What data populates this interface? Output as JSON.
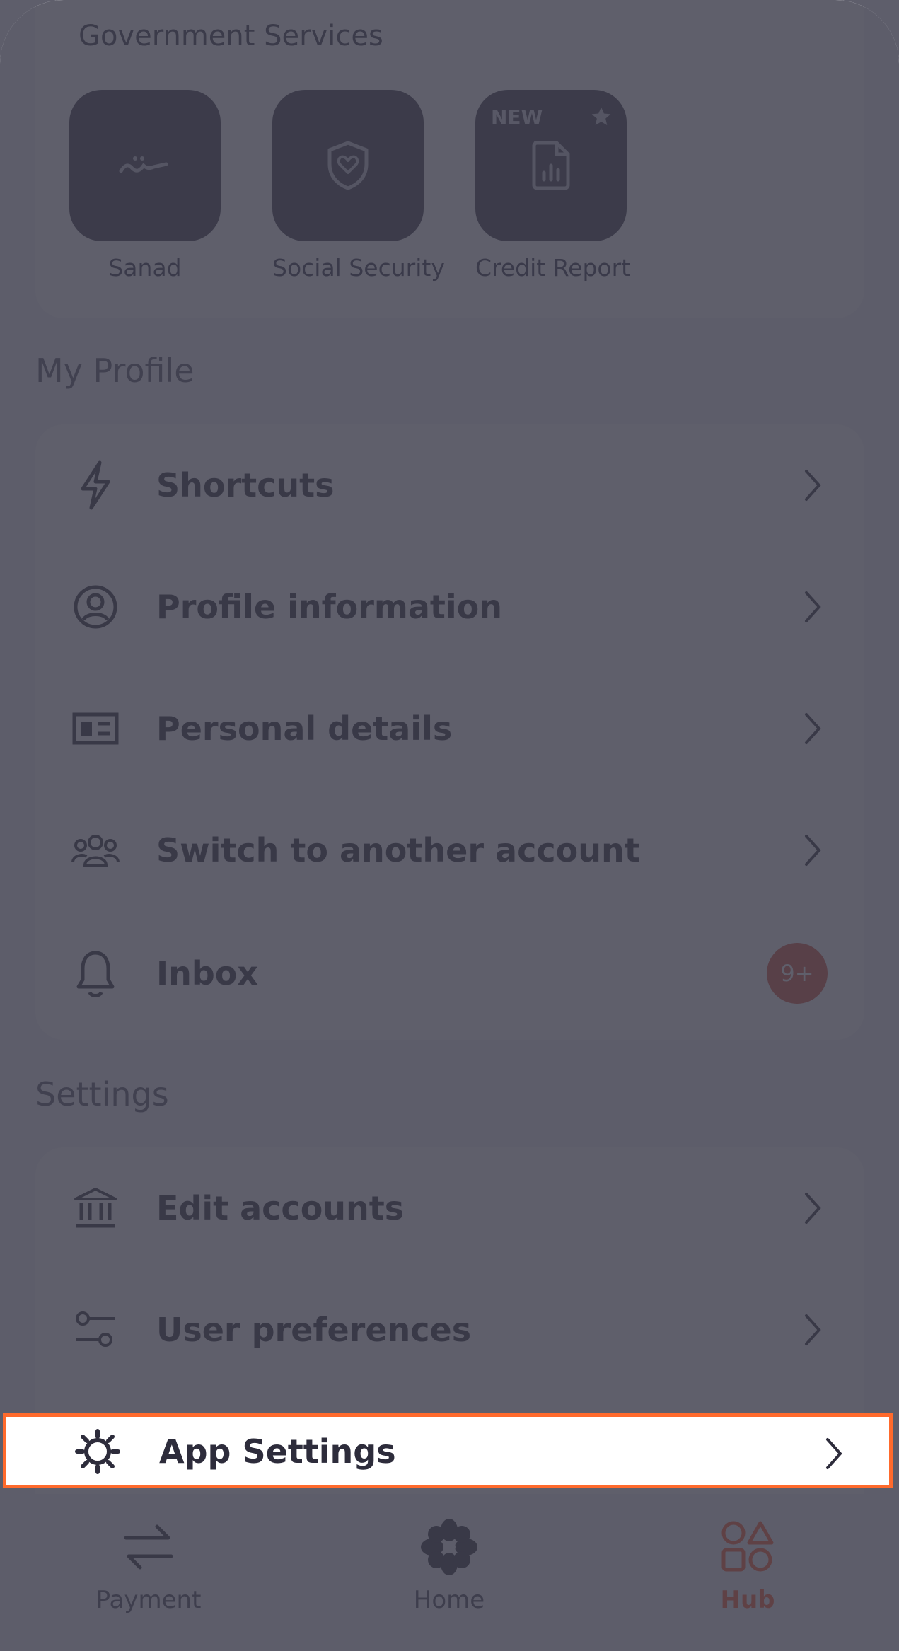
{
  "government": {
    "title": "Government Services",
    "tiles": [
      {
        "label": "Sanad",
        "icon": "sanad-icon"
      },
      {
        "label": "Social Security",
        "icon": "shield-heart-icon"
      },
      {
        "label": "Credit Report",
        "icon": "report-icon",
        "tag": "NEW"
      }
    ]
  },
  "profile": {
    "title": "My Profile",
    "items": [
      {
        "label": "Shortcuts",
        "icon": "lightning-icon"
      },
      {
        "label": "Profile information",
        "icon": "user-circle-icon"
      },
      {
        "label": "Personal details",
        "icon": "id-card-icon"
      },
      {
        "label": "Switch to another account",
        "icon": "users-icon"
      },
      {
        "label": "Inbox",
        "icon": "bell-icon",
        "badge": "9+"
      }
    ]
  },
  "settings": {
    "title": "Settings",
    "items": [
      {
        "label": "Edit accounts",
        "icon": "bank-icon"
      },
      {
        "label": "User preferences",
        "icon": "sliders-icon"
      },
      {
        "label": "App Settings",
        "icon": "gear-icon"
      }
    ]
  },
  "tabbar": {
    "tabs": [
      {
        "label": "Payment",
        "icon": "transfer-arrows-icon"
      },
      {
        "label": "Home",
        "icon": "flower-icon"
      },
      {
        "label": "Hub",
        "icon": "shapes-icon",
        "active": true
      }
    ]
  },
  "colors": {
    "accent": "#ff5a2c",
    "badge": "#d9533d",
    "highlight_border": "#ff6a2c"
  }
}
